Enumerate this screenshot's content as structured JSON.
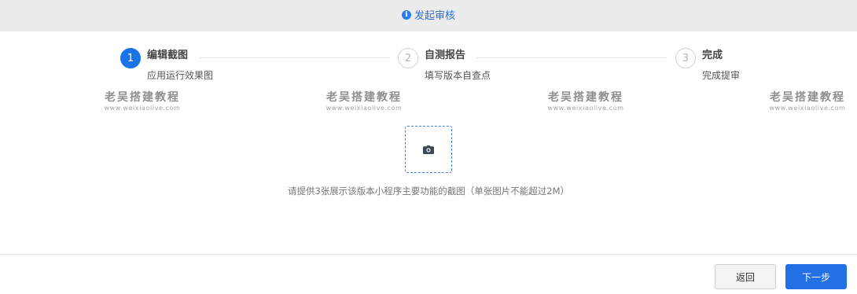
{
  "header": {
    "icon": "info-icon",
    "title": "发起审核",
    "accent_color": "#2d6fd3"
  },
  "steps": [
    {
      "number": "1",
      "title": "编辑截图",
      "desc": "应用运行效果图",
      "state": "active"
    },
    {
      "number": "2",
      "title": "自测报告",
      "desc": "填写版本自查点",
      "state": "pending"
    },
    {
      "number": "3",
      "title": "完成",
      "desc": "完成提审",
      "state": "pending"
    }
  ],
  "watermarks": [
    {
      "title": "老吴搭建教程",
      "url": "www.weixiaolive.com"
    },
    {
      "title": "老吴搭建教程",
      "url": "www.weixiaolive.com"
    },
    {
      "title": "老吴搭建教程",
      "url": "www.weixiaolive.com"
    },
    {
      "title": "老吴搭建教程",
      "url": "www.weixiaolive.com"
    }
  ],
  "upload": {
    "icon": "camera-icon",
    "hint": "请提供3张展示该版本小程序主要功能的截图（单张图片不能超过2M）"
  },
  "footer": {
    "back_label": "返回",
    "next_label": "下一步",
    "primary_color": "#2370e3"
  }
}
